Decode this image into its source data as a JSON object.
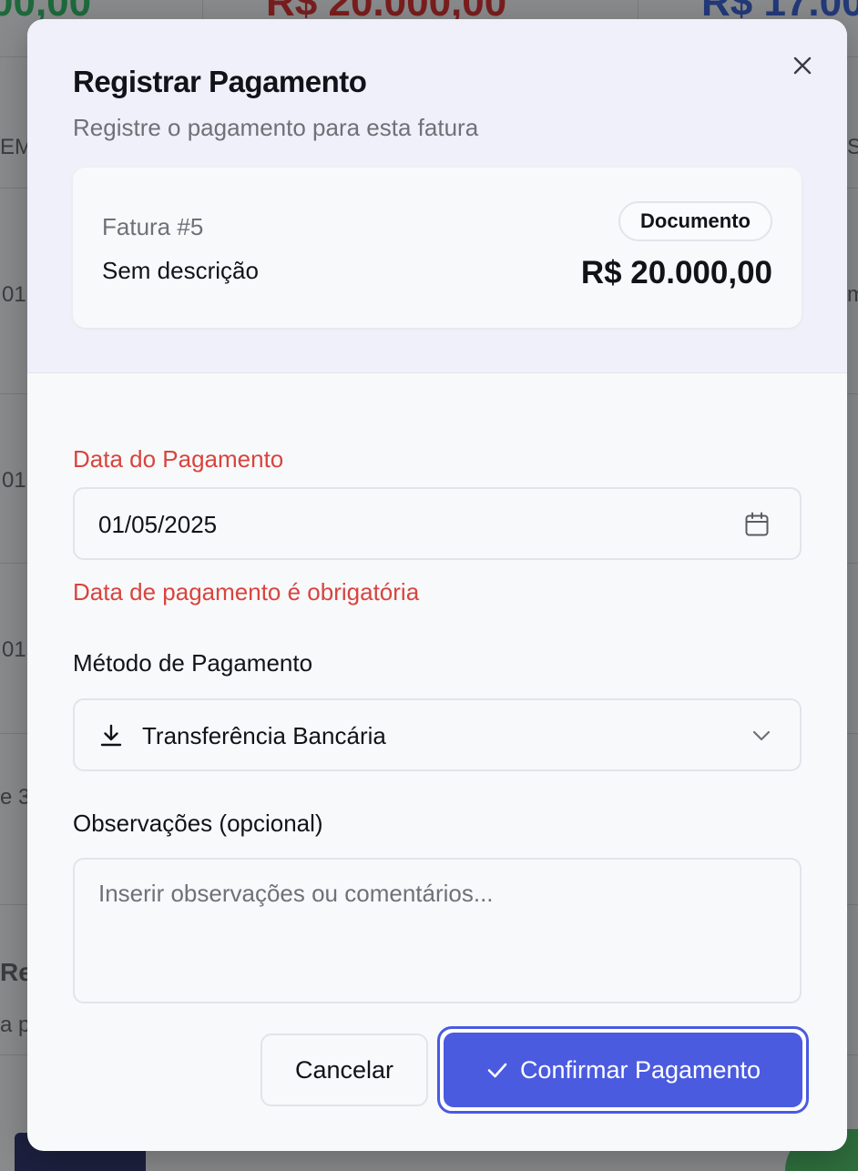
{
  "modal": {
    "title": "Registrar Pagamento",
    "subtitle": "Registre o pagamento para esta fatura",
    "close_icon": "close-icon"
  },
  "invoice": {
    "number": "Fatura #5",
    "description": "Sem descrição",
    "badge": "Documento",
    "amount": "R$ 20.000,00"
  },
  "form": {
    "payment_date": {
      "label": "Data do Pagamento",
      "value": "01/05/2025",
      "icon": "calendar-icon",
      "error": "Data de pagamento é obrigatória"
    },
    "payment_method": {
      "label": "Método de Pagamento",
      "value": "Transferência Bancária",
      "icon": "download-icon"
    },
    "notes": {
      "label": "Observações (opcional)",
      "placeholder": "Inserir observações ou comentários..."
    }
  },
  "actions": {
    "cancel_label": "Cancelar",
    "confirm_label": "Confirmar Pagamento"
  },
  "colors": {
    "primary": "#4a5be0",
    "error": "#d9443d",
    "header_bg": "#eff0f9"
  }
}
